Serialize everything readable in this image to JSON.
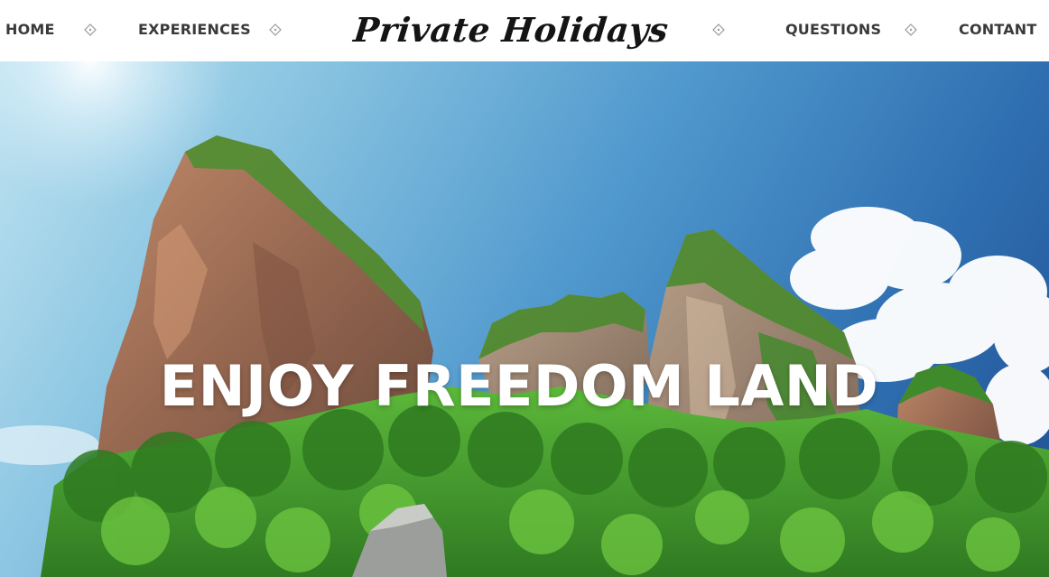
{
  "nav": {
    "left_items": [
      {
        "label": "HOME"
      },
      {
        "label": "EXPERIENCES"
      }
    ],
    "right_items": [
      {
        "label": "QUESTIONS"
      },
      {
        "label": "CONTANT"
      }
    ],
    "separator_icon": "diamond-ornament-icon",
    "link_color": "#3a3a3a"
  },
  "brand": {
    "title": "Private Holidays",
    "color": "#141414"
  },
  "hero": {
    "headline": "ENJOY FREEDOM LAND",
    "headline_color": "#ffffff",
    "sky_color_top": "#1f4f92",
    "sky_color_light": "#bfe3f1",
    "foliage_color": "#3f9a2c"
  }
}
